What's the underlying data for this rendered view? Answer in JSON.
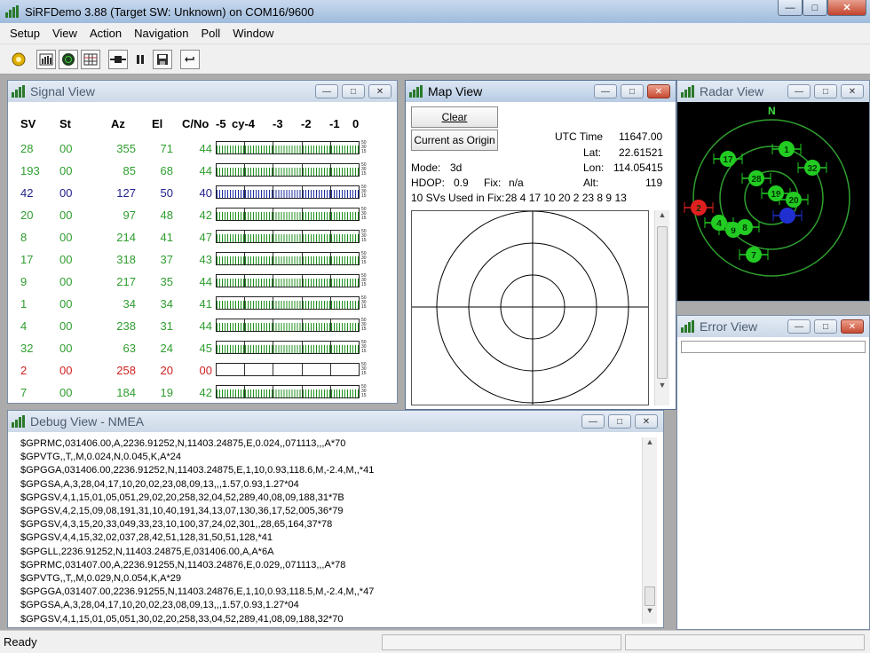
{
  "window": {
    "title": "SiRFDemo 3.88 (Target SW: Unknown) on COM16/9600"
  },
  "menu": [
    "Setup",
    "View",
    "Action",
    "Navigation",
    "Poll",
    "Window"
  ],
  "toolbar": {
    "icons": [
      "gear-icon",
      "signal-view-icon",
      "radar-view-icon",
      "grid-view-icon",
      "connect-icon",
      "pause-icon",
      "save-icon",
      "reset-icon"
    ]
  },
  "signal_view": {
    "title": "Signal View",
    "headers": [
      "SV",
      "St",
      "Az",
      "El",
      "C/No"
    ],
    "scale": [
      "-5",
      "cy-4",
      "-3",
      "-2",
      "-1",
      "0"
    ],
    "tick_labels": [
      "50",
      "30",
      "15"
    ],
    "rows": [
      {
        "sv": "28",
        "st": "00",
        "az": "355",
        "el": "71",
        "cn": "44",
        "color": "#2f9e2f",
        "bar": "green"
      },
      {
        "sv": "193",
        "st": "00",
        "az": "85",
        "el": "68",
        "cn": "44",
        "color": "#2f9e2f",
        "bar": "green"
      },
      {
        "sv": "42",
        "st": "00",
        "az": "127",
        "el": "50",
        "cn": "40",
        "color": "#23238c",
        "bar": "blue"
      },
      {
        "sv": "20",
        "st": "00",
        "az": "97",
        "el": "48",
        "cn": "42",
        "color": "#2f9e2f",
        "bar": "green"
      },
      {
        "sv": "8",
        "st": "00",
        "az": "214",
        "el": "41",
        "cn": "47",
        "color": "#2f9e2f",
        "bar": "green"
      },
      {
        "sv": "17",
        "st": "00",
        "az": "318",
        "el": "37",
        "cn": "43",
        "color": "#2f9e2f",
        "bar": "green"
      },
      {
        "sv": "9",
        "st": "00",
        "az": "217",
        "el": "35",
        "cn": "44",
        "color": "#2f9e2f",
        "bar": "green"
      },
      {
        "sv": "1",
        "st": "00",
        "az": "34",
        "el": "34",
        "cn": "41",
        "color": "#2f9e2f",
        "bar": "green"
      },
      {
        "sv": "4",
        "st": "00",
        "az": "238",
        "el": "31",
        "cn": "44",
        "color": "#2f9e2f",
        "bar": "green"
      },
      {
        "sv": "32",
        "st": "00",
        "az": "63",
        "el": "24",
        "cn": "45",
        "color": "#2f9e2f",
        "bar": "green"
      },
      {
        "sv": "2",
        "st": "00",
        "az": "258",
        "el": "20",
        "cn": "00",
        "color": "#d02020",
        "bar": "empty"
      },
      {
        "sv": "7",
        "st": "00",
        "az": "184",
        "el": "19",
        "cn": "42",
        "color": "#2f9e2f",
        "bar": "green"
      }
    ]
  },
  "map_view": {
    "title": "Map View",
    "clear_label": "Clear",
    "origin_label": "Current as Origin",
    "utc_label": "UTC Time",
    "utc_value": "11647.00",
    "lat_label": "Lat:",
    "lat_value": "22.61521",
    "lon_label": "Lon:",
    "lon_value": "114.05415",
    "alt_label": "Alt:",
    "alt_value": "119",
    "mode_label": "Mode:",
    "mode_value": "3d",
    "hdop_label": "HDOP:",
    "hdop_value": "0.9",
    "fix_label": "Fix:",
    "fix_value": "n/a",
    "svs_used_label": "10 SVs Used in Fix:",
    "svs_used_value": "28 4 17 10 20 2 23 8 9 13"
  },
  "radar_view": {
    "title": "Radar View",
    "north": "N",
    "sats": [
      {
        "id": "1",
        "color": "#22cc22"
      },
      {
        "id": "17",
        "color": "#22cc22"
      },
      {
        "id": "32",
        "color": "#22cc22"
      },
      {
        "id": "28",
        "color": "#22cc22"
      },
      {
        "id": "19",
        "color": "#22cc22"
      },
      {
        "id": "20",
        "color": "#22cc22"
      },
      {
        "id": "2",
        "color": "#e02020"
      },
      {
        "id": "4",
        "color": "#22cc22"
      },
      {
        "id": "9",
        "color": "#22cc22"
      },
      {
        "id": "8",
        "color": "#22cc22"
      },
      {
        "id": "7",
        "color": "#22cc22"
      },
      {
        "id": "",
        "color": "#2030d0"
      }
    ]
  },
  "error_view": {
    "title": "Error View"
  },
  "debug_view": {
    "title": "Debug View - NMEA",
    "lines": [
      "$GPRMC,031406.00,A,2236.91252,N,11403.24875,E,0.024,,071113,,,A*70",
      "$GPVTG,,T,,M,0.024,N,0.045,K,A*24",
      "$GPGGA,031406.00,2236.91252,N,11403.24875,E,1,10,0.93,118.6,M,-2.4,M,,*41",
      "$GPGSA,A,3,28,04,17,10,20,02,23,08,09,13,,,1.57,0.93,1.27*04",
      "$GPGSV,4,1,15,01,05,051,29,02,20,258,32,04,52,289,40,08,09,188,31*7B",
      "$GPGSV,4,2,15,09,08,191,31,10,40,191,34,13,07,130,36,17,52,005,36*79",
      "$GPGSV,4,3,15,20,33,049,33,23,10,100,37,24,02,301,,28,65,164,37*78",
      "$GPGSV,4,4,15,32,02,037,28,42,51,128,31,50,51,128,*41",
      "$GPGLL,2236.91252,N,11403.24875,E,031406.00,A,A*6A",
      "$GPRMC,031407.00,A,2236.91255,N,11403.24876,E,0.029,,071113,,,A*78",
      "$GPVTG,,T,,M,0.029,N,0.054,K,A*29",
      "$GPGGA,031407.00,2236.91255,N,11403.24876,E,1,10,0.93,118.5,M,-2.4,M,,*47",
      "$GPGSA,A,3,28,04,17,10,20,02,23,08,09,13,,,1.57,0.93,1.27*04",
      "$GPGSV,4,1,15,01,05,051,30,02,20,258,33,04,52,289,41,08,09,188,32*70"
    ]
  },
  "status": {
    "text": "Ready"
  }
}
